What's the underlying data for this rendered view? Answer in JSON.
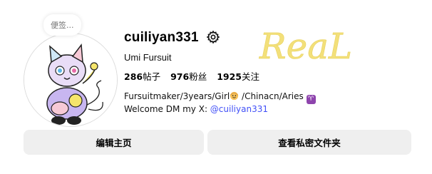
{
  "note": {
    "text": "便签..."
  },
  "profile": {
    "username": "cuiliyan331",
    "full_name": "Umi Fursuit",
    "stats": [
      {
        "count": "286",
        "label": "帖子"
      },
      {
        "count": "976",
        "label": "粉丝"
      },
      {
        "count": "1925",
        "label": "关注"
      }
    ],
    "bio_line1_text": "Fursuitmaker/3years/Girl",
    "bio_line1_tail": " /China",
    "bio_line1_cn": "cn",
    "bio_line1_end": "/Aries ",
    "bio_line2_prefix": "Welcome DM my X: ",
    "bio_line2_mention": "@cuiliyan331"
  },
  "overlay": {
    "handwritten_text": "ReaL"
  },
  "buttons": {
    "edit_profile": "编辑主页",
    "view_archive": "查看私密文件夹"
  },
  "colors": {
    "link": "#4150f7",
    "button_bg": "#efefef",
    "scribble": "#f3e07a"
  },
  "icons": {
    "settings": "gear-icon",
    "girl_emoji": "girl-emoji-icon",
    "aries": "aries-zodiac-icon"
  }
}
